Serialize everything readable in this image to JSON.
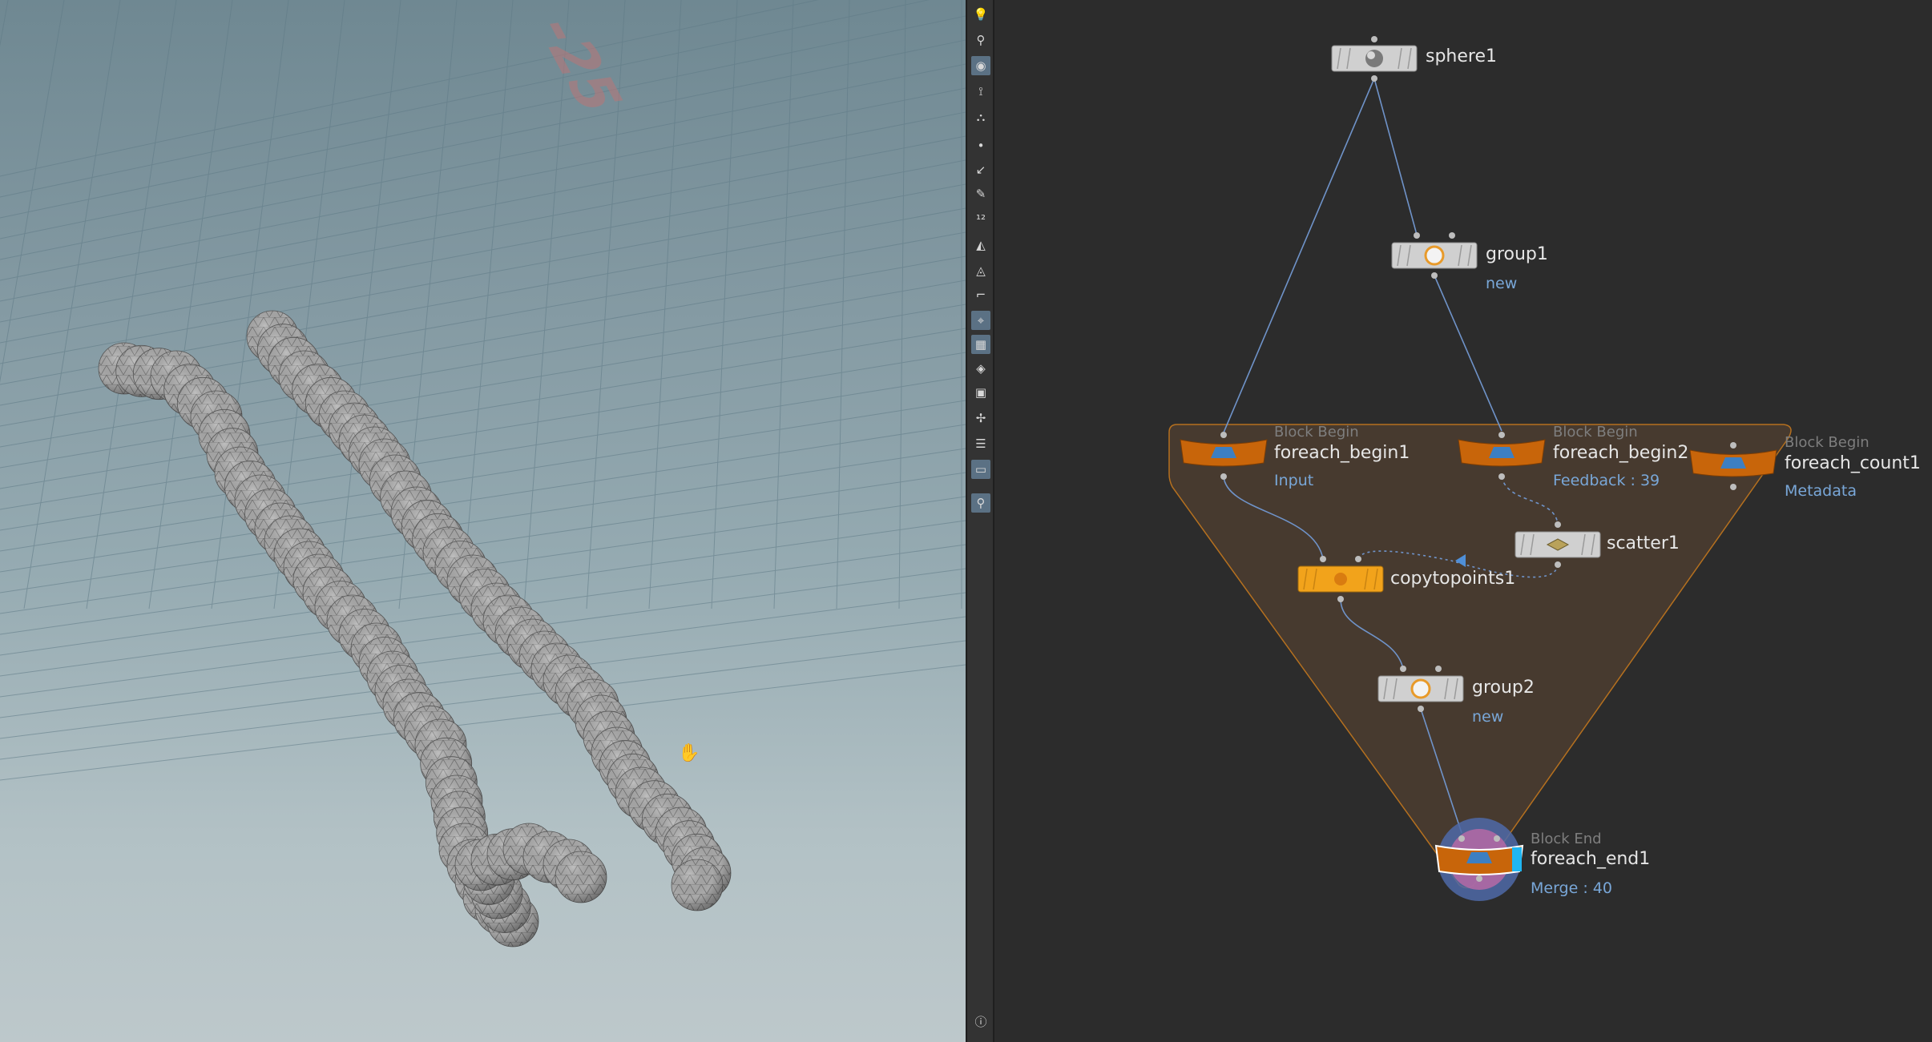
{
  "viewport": {
    "grid_label": "-25",
    "cursor_icon": "hand-cursor-icon"
  },
  "toolbar": {
    "icons": [
      "light-icon",
      "spot-light-icon",
      "display-options-icon",
      "ghost-icon",
      "camera-icon",
      "point-icon",
      "edge-icon",
      "pen-icon",
      "point-numbers-icon",
      "shading-icon",
      "wireframe-icon",
      "guide-icon",
      "visualize-icon",
      "background-icon",
      "normal-icon",
      "display-icon",
      "snap-icon",
      "layers-icon",
      "image-icon",
      "pin-icon",
      "info-icon"
    ],
    "colors": {
      "active": "#5b7184"
    }
  },
  "network": {
    "nodes": {
      "sphere1": {
        "name": "sphere1"
      },
      "group1": {
        "name": "group1",
        "info": "new"
      },
      "foreach_begin1": {
        "block": "Block Begin",
        "name": "foreach_begin1",
        "info": "Input"
      },
      "foreach_begin2": {
        "block": "Block Begin",
        "name": "foreach_begin2",
        "info": "Feedback : 39"
      },
      "foreach_count1": {
        "block": "Block Begin",
        "name": "foreach_count1",
        "info": "Metadata"
      },
      "scatter1": {
        "name": "scatter1"
      },
      "copytopoints1": {
        "name": "copytopoints1"
      },
      "group2": {
        "name": "group2",
        "info": "new"
      },
      "foreach_end1": {
        "block": "Block End",
        "name": "foreach_end1",
        "info": "Merge : 40"
      }
    },
    "colors": {
      "background": "#2c2c2c",
      "block_fill": "#4a3c30",
      "block_border": "#b5701f",
      "node_orange": "#c8650a",
      "node_yellow": "#f2a31b",
      "node_gray": "#d0d0d0",
      "wire": "#6f93c9",
      "info_text": "#79a7d8"
    }
  }
}
